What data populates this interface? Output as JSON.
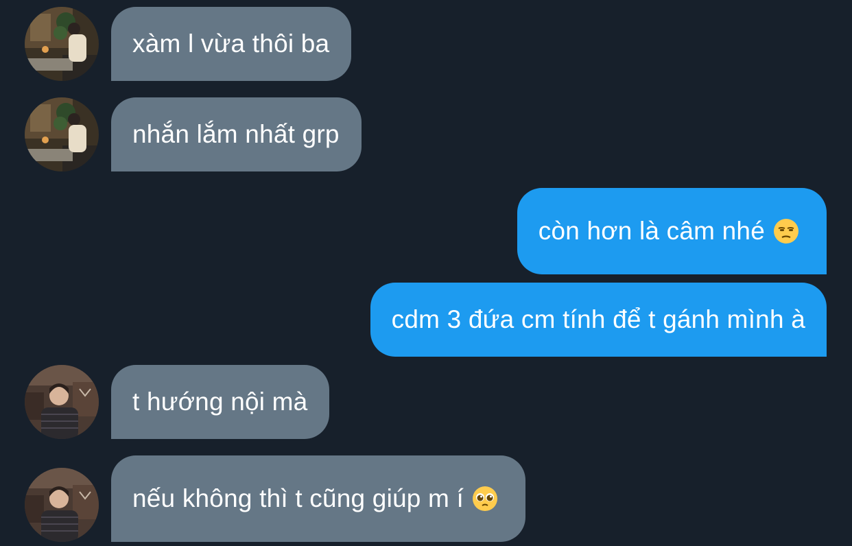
{
  "messages": [
    {
      "id": "m1",
      "direction": "incoming",
      "sender_avatar": "avatar-user-a",
      "text": "xàm l vừa thôi ba"
    },
    {
      "id": "m2",
      "direction": "incoming",
      "sender_avatar": "avatar-user-a",
      "text": "nhắn lắm nhất grp"
    },
    {
      "id": "m3",
      "direction": "outgoing",
      "text": "còn hơn là câm nhé",
      "emoji": "unamused-face-emoji"
    },
    {
      "id": "m4",
      "direction": "outgoing",
      "text": "cdm 3 đứa cm tính để t gánh mình à"
    },
    {
      "id": "m5",
      "direction": "incoming",
      "sender_avatar": "avatar-user-b",
      "text": "t hướng nội mà"
    },
    {
      "id": "m6",
      "direction": "incoming",
      "sender_avatar": "avatar-user-b",
      "text": "nếu không thì t cũng giúp m í",
      "emoji": "pleading-face-emoji"
    }
  ],
  "colors": {
    "background": "#17202b",
    "incoming_bubble": "#657786",
    "outgoing_bubble": "#1d9bf0",
    "text": "#ffffff"
  }
}
